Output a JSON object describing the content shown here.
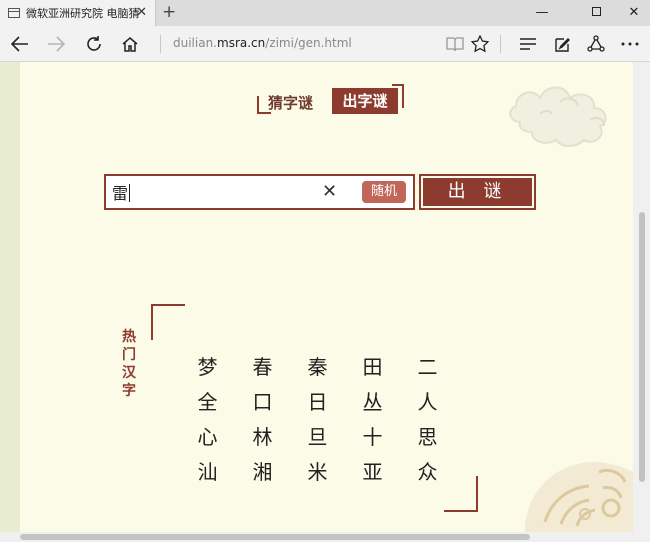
{
  "browser": {
    "tab_title": "微软亚洲研究院 电脑猜",
    "new_tab_label": "+",
    "url_prefix": "duilian.",
    "url_host": "msra.cn",
    "url_path": "/zimi/gen.html"
  },
  "page": {
    "modes": {
      "guess_label": "猜字谜",
      "make_label": "出字谜",
      "active": "make"
    },
    "search": {
      "value": "雷",
      "random_label": "随机",
      "submit_label": "出 谜"
    },
    "hot": {
      "title": "热门汉字",
      "chars": [
        "梦",
        "春",
        "秦",
        "田",
        "二",
        "全",
        "口",
        "日",
        "丛",
        "人",
        "心",
        "林",
        "旦",
        "十",
        "思",
        "汕",
        "湘",
        "米",
        "亚",
        "众"
      ]
    }
  }
}
